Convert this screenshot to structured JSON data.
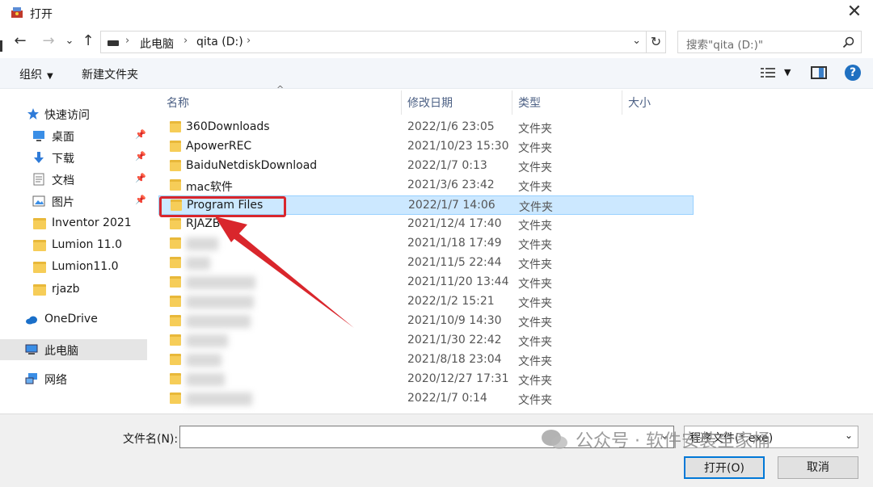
{
  "window": {
    "title": "打开",
    "close_glyph": "✕"
  },
  "nav": {
    "back_glyph": "←",
    "forward_glyph": "→",
    "recent_glyph": "⌄",
    "up_glyph": "↑",
    "breadcrumb": [
      "此电脑",
      "qita (D:)"
    ],
    "refresh_glyph": "↻",
    "search_placeholder": "搜索\"qita (D:)\""
  },
  "toolbar": {
    "organize": "组织",
    "new_folder": "新建文件夹",
    "help": "?"
  },
  "sidebar": {
    "quick_access": "快速访问",
    "items": [
      {
        "label": "桌面",
        "icon": "desktop-icon",
        "pinned": true
      },
      {
        "label": "下载",
        "icon": "download-icon",
        "pinned": true
      },
      {
        "label": "文档",
        "icon": "document-icon",
        "pinned": true
      },
      {
        "label": "图片",
        "icon": "picture-icon",
        "pinned": true
      },
      {
        "label": "Inventor 2021",
        "icon": "folder-icon"
      },
      {
        "label": "Lumion 11.0",
        "icon": "folder-icon"
      },
      {
        "label": "Lumion11.0",
        "icon": "folder-icon"
      },
      {
        "label": "rjazb",
        "icon": "folder-icon"
      }
    ],
    "onedrive": "OneDrive",
    "this_pc": "此电脑",
    "network": "网络"
  },
  "columns": {
    "name": "名称",
    "date": "修改日期",
    "type": "类型",
    "size": "大小"
  },
  "files": [
    {
      "name": "360Downloads",
      "date": "2022/1/6 23:05",
      "type": "文件夹"
    },
    {
      "name": "ApowerREC",
      "date": "2021/10/23 15:30",
      "type": "文件夹"
    },
    {
      "name": "BaiduNetdiskDownload",
      "date": "2022/1/7 0:13",
      "type": "文件夹"
    },
    {
      "name": "mac软件",
      "date": "2021/3/6 23:42",
      "type": "文件夹"
    },
    {
      "name": "Program Files",
      "date": "2022/1/7 14:06",
      "type": "文件夹",
      "selected": true
    },
    {
      "name": "RJAZB",
      "date": "2021/12/4 17:40",
      "type": "文件夹"
    },
    {
      "name": "",
      "date": "2021/1/18 17:49",
      "type": "文件夹",
      "blurred": true
    },
    {
      "name": "",
      "date": "2021/11/5 22:44",
      "type": "文件夹",
      "blurred": true
    },
    {
      "name": "",
      "date": "2021/11/20 13:44",
      "type": "文件夹",
      "blurred": true
    },
    {
      "name": "",
      "date": "2022/1/2 15:21",
      "type": "文件夹",
      "blurred": true
    },
    {
      "name": "",
      "date": "2021/10/9 14:30",
      "type": "文件夹",
      "blurred": true
    },
    {
      "name": "",
      "date": "2021/1/30 22:42",
      "type": "文件夹",
      "blurred": true
    },
    {
      "name": "",
      "date": "2021/8/18 23:04",
      "type": "文件夹",
      "blurred": true
    },
    {
      "name": "",
      "date": "2020/12/27 17:31",
      "type": "文件夹",
      "blurred": true
    },
    {
      "name": "",
      "date": "2022/1/7 0:14",
      "type": "文件夹",
      "blurred": true
    }
  ],
  "footer": {
    "filename_label": "文件名(N):",
    "filename_value": "",
    "filetype": "程序文件(*.exe)",
    "open_button": "打开(O)",
    "cancel_button": "取消"
  },
  "watermark": "公众号 · 软件安装全家桶",
  "colors": {
    "accent": "#0078d7",
    "highlight": "#d9262c",
    "selection": "#cce8ff",
    "folder": "#f6cd58"
  }
}
